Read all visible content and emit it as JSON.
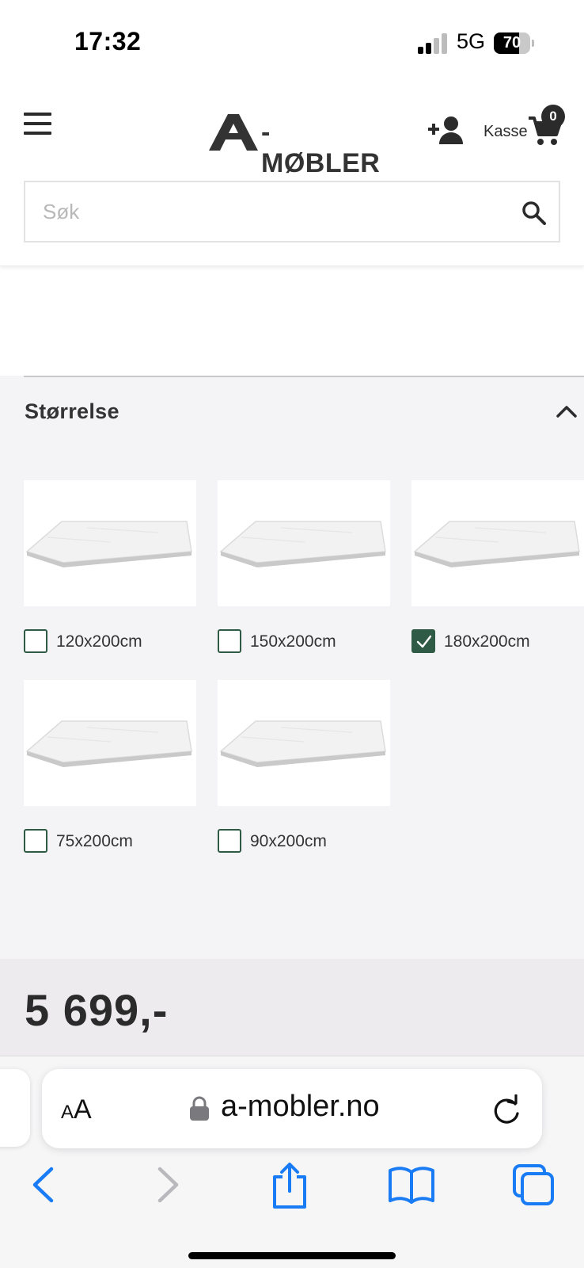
{
  "status_bar": {
    "time": "17:32",
    "network": "5G",
    "battery": "70",
    "battery_level": 0.7,
    "signal_bars_active": 2,
    "signal_bars_total": 4
  },
  "header": {
    "logo_text": "-MØBLER",
    "cart_label": "Kasse",
    "cart_count": "0",
    "search": {
      "placeholder": "Søk",
      "value": ""
    }
  },
  "filter": {
    "title": "Størrelse",
    "expanded": true,
    "options": [
      {
        "label": "120x200cm",
        "checked": false
      },
      {
        "label": "150x200cm",
        "checked": false
      },
      {
        "label": "180x200cm",
        "checked": true
      },
      {
        "label": "75x200cm",
        "checked": false
      },
      {
        "label": "90x200cm",
        "checked": false
      }
    ]
  },
  "price": "5 699,-",
  "browser": {
    "aa_label_small": "A",
    "aa_label_large": "A",
    "url": "a-mobler.no"
  },
  "colors": {
    "brand_dark": "#2b2b2b",
    "checkbox_accent": "#2f5a45",
    "ios_blue": "#1a7cf5",
    "filter_bg": "#f4f3f6"
  },
  "icons": [
    "menu-icon",
    "add-user-icon",
    "cart-icon",
    "search-icon",
    "chevron-up-icon",
    "lock-icon",
    "reload-icon",
    "back-icon",
    "forward-icon",
    "share-icon",
    "bookmarks-icon",
    "tabs-icon"
  ]
}
